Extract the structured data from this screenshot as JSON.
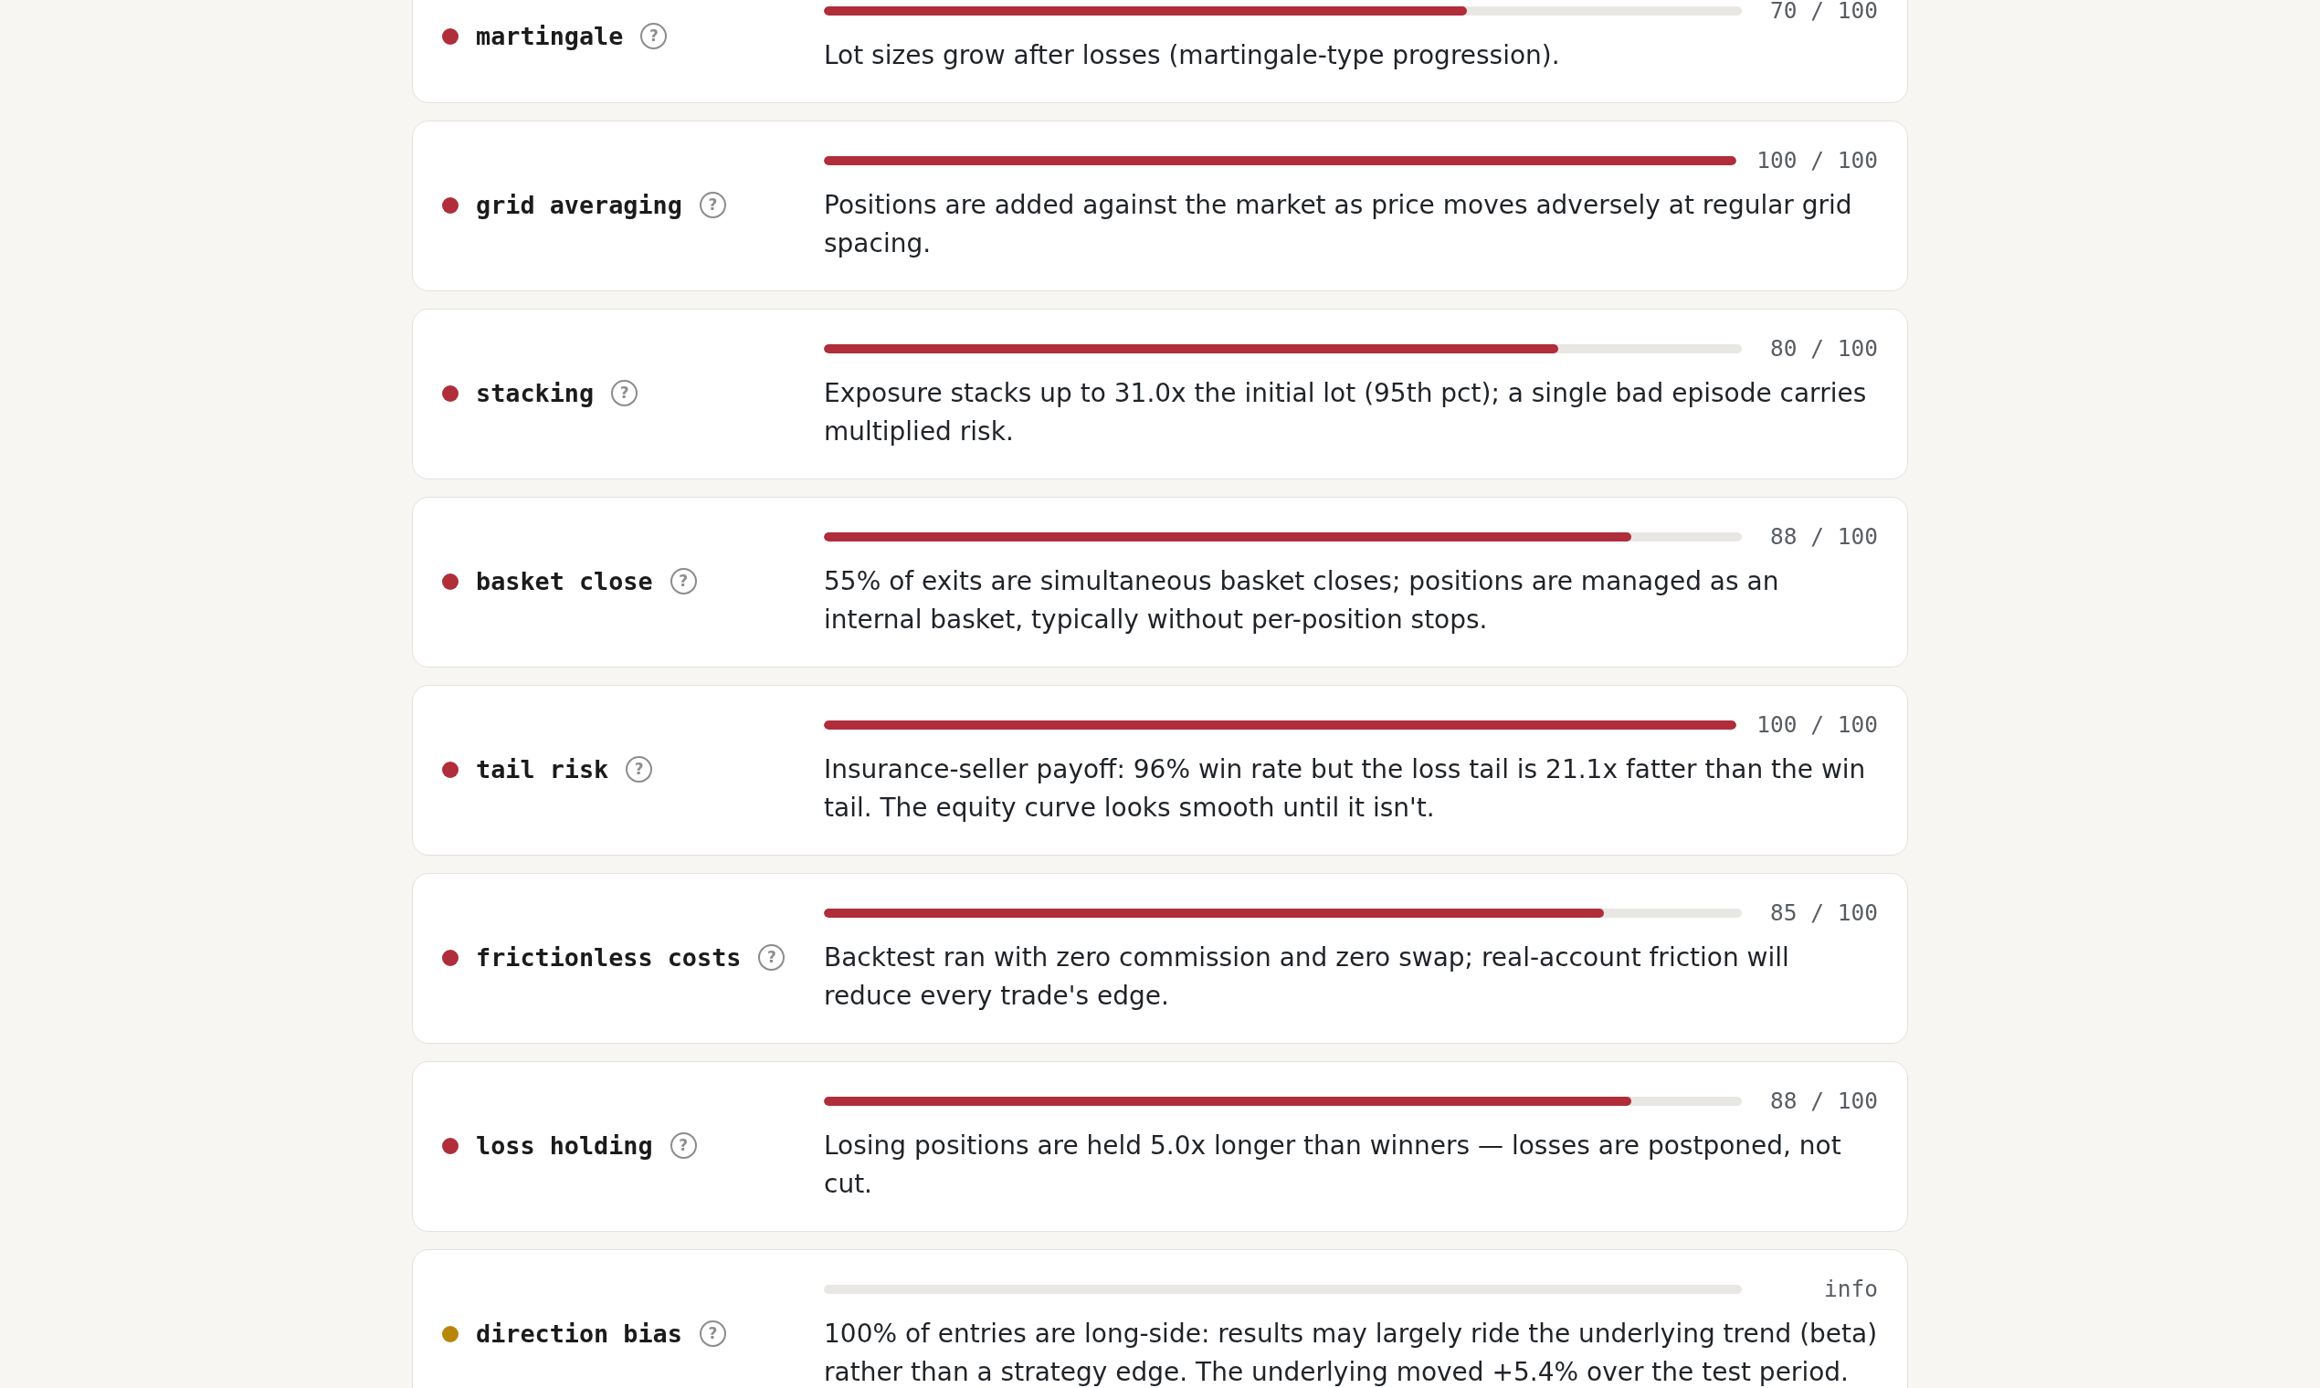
{
  "risk_factors": [
    {
      "name": "martingale",
      "color": "#b02d3a",
      "help": "?",
      "level": 0.7,
      "score": "70 / 100",
      "description": "Lot sizes grow after losses (martingale-type progression)."
    },
    {
      "name": "grid averaging",
      "color": "#b02d3a",
      "help": "?",
      "level": 1.0,
      "score": "100 / 100",
      "description": "Positions are added against the market as price moves adversely at regular grid spacing."
    },
    {
      "name": "stacking",
      "color": "#b02d3a",
      "help": "?",
      "level": 0.8,
      "score": "80 / 100",
      "description": "Exposure stacks up to 31.0x the initial lot (95th pct); a single bad episode carries multiplied risk."
    },
    {
      "name": "basket close",
      "color": "#b02d3a",
      "help": "?",
      "level": 0.88,
      "score": "88 / 100",
      "description": "55% of exits are simultaneous basket closes; positions are managed as an internal basket, typically without per-position stops."
    },
    {
      "name": "tail risk",
      "color": "#b02d3a",
      "help": "?",
      "level": 1.0,
      "score": "100 / 100",
      "description": "Insurance-seller payoff: 96% win rate but the loss tail is 21.1x fatter than the win tail. The equity curve looks smooth until it isn't."
    },
    {
      "name": "frictionless costs",
      "color": "#b02d3a",
      "help": "?",
      "level": 0.85,
      "score": "85 / 100",
      "description": "Backtest ran with zero commission and zero swap; real-account friction will reduce every trade's edge."
    },
    {
      "name": "loss holding",
      "color": "#b02d3a",
      "help": "?",
      "level": 0.88,
      "score": "88 / 100",
      "description": "Losing positions are held 5.0x longer than winners — losses are postponed, not cut."
    },
    {
      "name": "direction bias",
      "color": "#b8860b",
      "help": "?",
      "score": "info",
      "description": "100% of entries are long-side: results may largely ride the underlying trend (beta) rather than a strategy edge. The underlying moved +5.4% over the test period."
    }
  ]
}
